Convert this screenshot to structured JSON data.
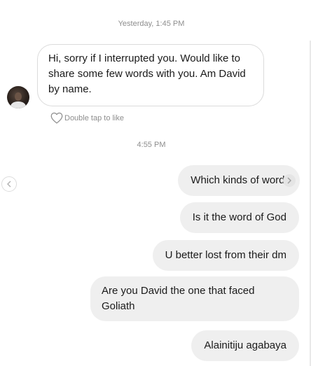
{
  "timestamps": {
    "first": "Yesterday, 1:45 PM",
    "second": "4:55 PM"
  },
  "incoming": {
    "text": "Hi,  sorry if I interrupted you.  Would like to share some few words with you. Am David by name.",
    "like_hint": "Double tap to like"
  },
  "outgoing": [
    {
      "text": "Which kinds of words"
    },
    {
      "text": "Is it the word of God"
    },
    {
      "text": "U better lost from their dm"
    },
    {
      "text": "Are you David the one that faced Goliath"
    },
    {
      "text": "Alainitiju agabaya"
    }
  ],
  "icons": {
    "heart": "heart-outline-icon",
    "prev": "chevron-left-icon",
    "next": "chevron-right-icon"
  },
  "colors": {
    "bubble_out": "#efefef",
    "bubble_in_border": "#dbdbdb",
    "meta_text": "#8e8e8e"
  }
}
